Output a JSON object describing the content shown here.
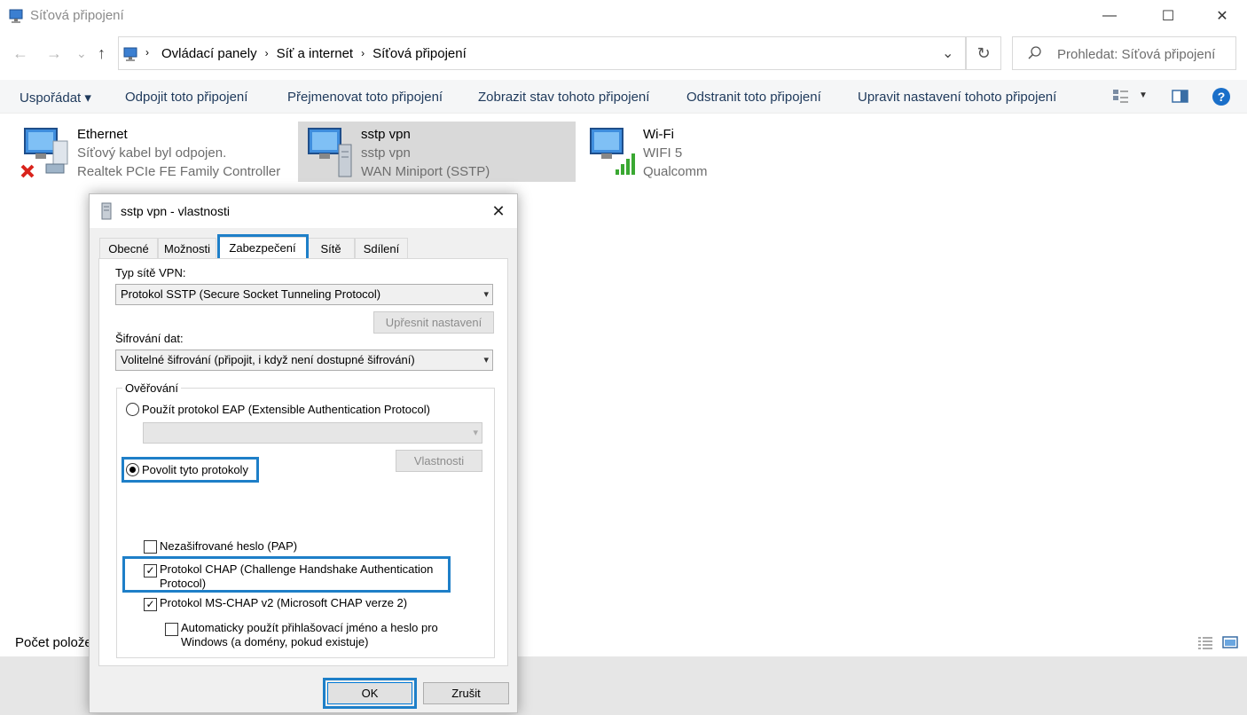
{
  "window": {
    "title": "Síťová připojení",
    "controls": [
      "—",
      "☐",
      "✕"
    ]
  },
  "nav": {
    "back": "←",
    "forward": "→",
    "recent": "⌄",
    "up": "↑"
  },
  "address": {
    "crumbs": [
      "Ovládací panely",
      "Síť a internet",
      "Síťová připojení"
    ],
    "separator": "›",
    "dropdown": "⌄",
    "refresh": "↻"
  },
  "search": {
    "placeholder": "Prohledat: Síťová připojení"
  },
  "commands": [
    "Uspořádat ▾",
    "Odpojit toto připojení",
    "Přejmenovat toto připojení",
    "Zobrazit stav tohoto připojení",
    "Odstranit toto připojení",
    "Upravit nastavení tohoto připojení"
  ],
  "connections": [
    {
      "name": "Ethernet",
      "status": "Síťový kabel byl odpojen.",
      "device": "Realtek PCIe FE Family Controller"
    },
    {
      "name": "sstp vpn",
      "status": "sstp vpn",
      "device": "WAN Miniport (SSTP)"
    },
    {
      "name": "Wi-Fi",
      "status": "WIFI 5",
      "device": "Qualcomm"
    }
  ],
  "statusbar": {
    "items_label": "Počet polože"
  },
  "dialog": {
    "title": "sstp vpn - vlastnosti",
    "close": "✕",
    "tabs": [
      "Obecné",
      "Možnosti",
      "Zabezpečení",
      "Sítě",
      "Sdílení"
    ],
    "vpn_type_label": "Typ sítě VPN:",
    "vpn_type_value": "Protokol SSTP (Secure Socket Tunneling Protocol)",
    "advanced_button": "Upřesnit nastavení",
    "encryption_label": "Šifrování dat:",
    "encryption_value": "Volitelné šifrování (připojit, i když není dostupné šifrování)",
    "auth_group": "Ověřování",
    "eap_radio": "Použít protokol EAP (Extensible Authentication Protocol)",
    "eap_props_button": "Vlastnosti",
    "allow_radio": "Povolit tyto protokoly",
    "pap": "Nezašifrované heslo (PAP)",
    "chap_line1": "Protokol CHAP (Challenge Handshake Authentication",
    "chap_line2": "Protocol)",
    "mschap": "Protokol MS-CHAP v2 (Microsoft CHAP verze 2)",
    "auto_line1": "Automaticky použít přihlašovací jméno a heslo pro",
    "auto_line2": "Windows (a domény, pokud existuje)",
    "ok": "OK",
    "cancel": "Zrušit",
    "checkmark": "✓"
  },
  "colors": {
    "highlight": "#1e7fc8",
    "command_text": "#1e395b",
    "selection": "#d9d9d9"
  }
}
